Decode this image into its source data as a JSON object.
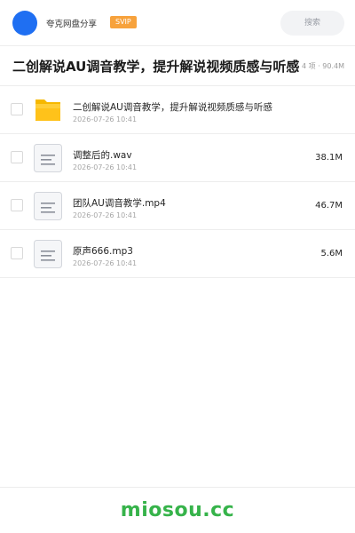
{
  "header": {
    "share_name": "夸克网盘分享",
    "badge": "SVIP",
    "search_placeholder": "搜索"
  },
  "folder": {
    "title": "二创解说AU调音教学，提升解说视频质感与听感",
    "summary": "4 项 · 90.4M"
  },
  "files": [
    {
      "name": "二创解说AU调音教学，提升解说视频质感与听感",
      "date": "2026-07-26 10:41",
      "size": "",
      "icon": "folder-icon"
    },
    {
      "name": "调整后的.wav",
      "date": "2026-07-26 10:41",
      "size": "38.1M",
      "icon": "file-icon"
    },
    {
      "name": "团队AU调音教学.mp4",
      "date": "2026-07-26 10:41",
      "size": "46.7M",
      "icon": "file-icon"
    },
    {
      "name": "原声666.mp3",
      "date": "2026-07-26 10:41",
      "size": "5.6M",
      "icon": "file-icon"
    }
  ],
  "watermark": "miosou.cc",
  "colors": {
    "accent": "#1f6ff2",
    "badge": "#f7a23c",
    "folder": "#ffc21a",
    "watermark": "#36b34a"
  }
}
